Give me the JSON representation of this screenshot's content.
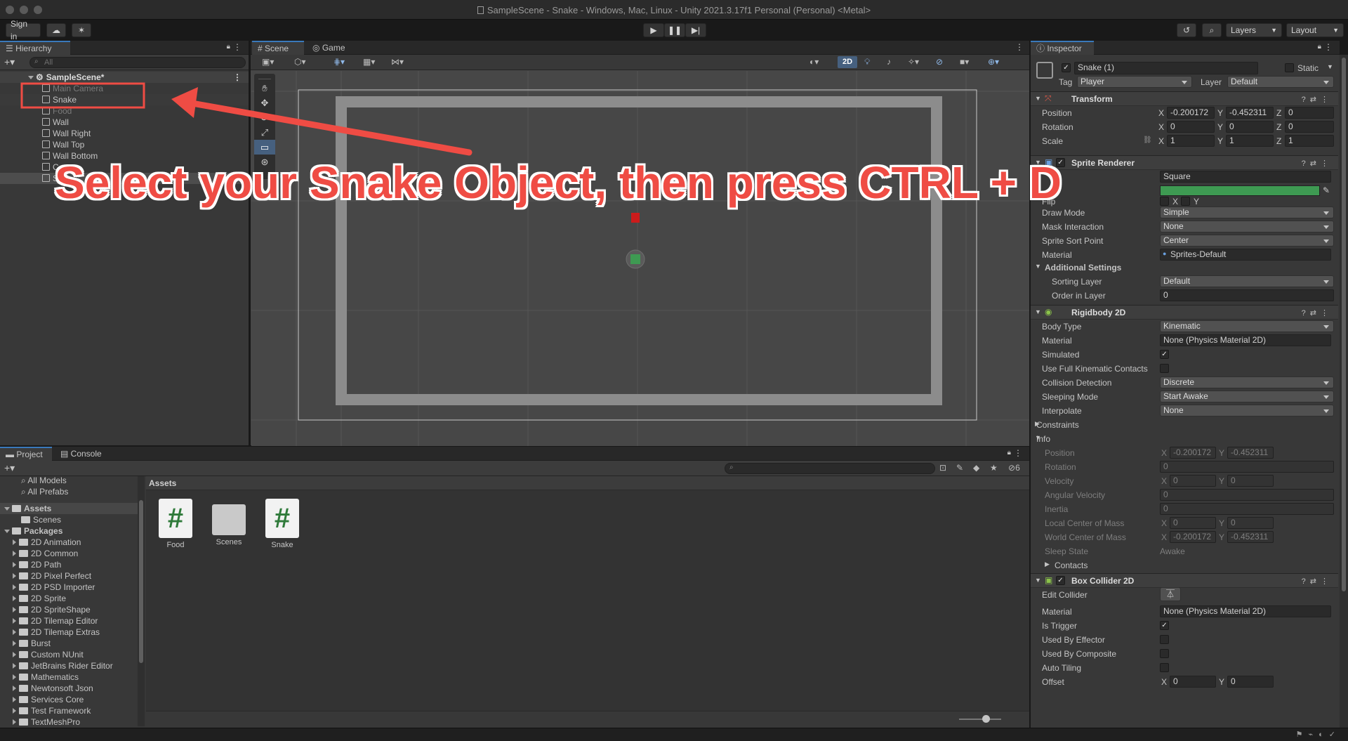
{
  "window": {
    "title": "SampleScene - Snake - Windows, Mac, Linux - Unity 2021.3.17f1 Personal (Personal) <Metal>"
  },
  "toolbar": {
    "sign_in": "Sign in",
    "layers": "Layers",
    "layout": "Layout"
  },
  "hierarchy": {
    "tab": "Hierarchy",
    "search_placeholder": "All",
    "scene": "SampleScene*",
    "items": [
      {
        "label": "Main Camera",
        "strike": true
      },
      {
        "label": "Snake"
      },
      {
        "label": "Food",
        "strike": true
      },
      {
        "label": "Wall"
      },
      {
        "label": "Wall Right"
      },
      {
        "label": "Wall Top"
      },
      {
        "label": "Wall Bottom"
      },
      {
        "label": "C"
      },
      {
        "label": "S"
      }
    ]
  },
  "scene": {
    "tabs": [
      "Scene",
      "Game"
    ],
    "mode_2d": "2D"
  },
  "annotation": {
    "text": "Select your Snake Object, then press CTRL + D",
    "color": "#ef4c44"
  },
  "project": {
    "tabs": [
      "Project",
      "Console"
    ],
    "count": "6",
    "favorites": [
      "All Models",
      "All Prefabs"
    ],
    "assets_label": "Assets",
    "assets_children": [
      "Scenes"
    ],
    "packages_label": "Packages",
    "packages": [
      "2D Animation",
      "2D Common",
      "2D Path",
      "2D Pixel Perfect",
      "2D PSD Importer",
      "2D Sprite",
      "2D SpriteShape",
      "2D Tilemap Editor",
      "2D Tilemap Extras",
      "Burst",
      "Custom NUnit",
      "JetBrains Rider Editor",
      "Mathematics",
      "Newtonsoft Json",
      "Services Core",
      "Test Framework",
      "TextMeshPro"
    ],
    "breadcrumb": "Assets",
    "grid": [
      {
        "label": "Food",
        "icon": "script-icon"
      },
      {
        "label": "Scenes",
        "icon": "folder-icon"
      },
      {
        "label": "Snake",
        "icon": "script-icon"
      }
    ]
  },
  "inspector": {
    "tab": "Inspector",
    "object_name": "Snake (1)",
    "static": "Static",
    "tag_label": "Tag",
    "tag": "Player",
    "layer_label": "Layer",
    "layer": "Default",
    "transform": {
      "title": "Transform",
      "rows": [
        {
          "label": "Position",
          "x": "-0.200172",
          "y": "-0.452311",
          "z": "0"
        },
        {
          "label": "Rotation",
          "x": "0",
          "y": "0",
          "z": "0"
        },
        {
          "label": "Scale",
          "x": "1",
          "y": "1",
          "z": "1"
        }
      ]
    },
    "sprite_renderer": {
      "title": "Sprite Renderer",
      "sprite": "Square",
      "color": "#3e9a52",
      "flip": "Flip",
      "rows": [
        {
          "label": "Draw Mode",
          "value": "Simple"
        },
        {
          "label": "Mask Interaction",
          "value": "None"
        },
        {
          "label": "Sprite Sort Point",
          "value": "Center"
        }
      ],
      "material_label": "Material",
      "material": "Sprites-Default",
      "additional": "Additional Settings",
      "sorting_layer_label": "Sorting Layer",
      "sorting_layer": "Default",
      "order_label": "Order in Layer",
      "order": "0"
    },
    "rigidbody": {
      "title": "Rigidbody 2D",
      "rows": [
        {
          "label": "Body Type",
          "value": "Kinematic",
          "kind": "drop"
        },
        {
          "label": "Material",
          "value": "None (Physics Material 2D)",
          "kind": "obj"
        },
        {
          "label": "Simulated",
          "value": "checked",
          "kind": "check"
        },
        {
          "label": "Use Full Kinematic Contacts",
          "value": "",
          "kind": "check"
        },
        {
          "label": "Collision Detection",
          "value": "Discrete",
          "kind": "drop"
        },
        {
          "label": "Sleeping Mode",
          "value": "Start Awake",
          "kind": "drop"
        },
        {
          "label": "Interpolate",
          "value": "None",
          "kind": "drop"
        }
      ],
      "constraints": "Constraints",
      "info": "Info",
      "info_rows": [
        {
          "label": "Position",
          "x": "-0.200172",
          "y": "-0.452311"
        },
        {
          "label": "Rotation",
          "value": "0"
        },
        {
          "label": "Velocity",
          "x": "0",
          "y": "0"
        },
        {
          "label": "Angular Velocity",
          "value": "0"
        },
        {
          "label": "Inertia",
          "value": "0"
        },
        {
          "label": "Local Center of Mass",
          "x": "0",
          "y": "0"
        },
        {
          "label": "World Center of Mass",
          "x": "-0.200172",
          "y": "-0.452311"
        },
        {
          "label": "Sleep State",
          "text": "Awake"
        }
      ],
      "contacts": "Contacts"
    },
    "box_collider": {
      "title": "Box Collider 2D",
      "edit_label": "Edit Collider",
      "rows": [
        {
          "label": "Material",
          "value": "None (Physics Material 2D)",
          "kind": "obj"
        },
        {
          "label": "Is Trigger",
          "value": "checked",
          "kind": "check"
        },
        {
          "label": "Used By Effector",
          "value": "",
          "kind": "check"
        },
        {
          "label": "Used By Composite",
          "value": "",
          "kind": "check"
        },
        {
          "label": "Auto Tiling",
          "value": "",
          "kind": "check"
        }
      ],
      "offset_label": "Offset",
      "offset_x": "0",
      "offset_y": "0"
    }
  }
}
